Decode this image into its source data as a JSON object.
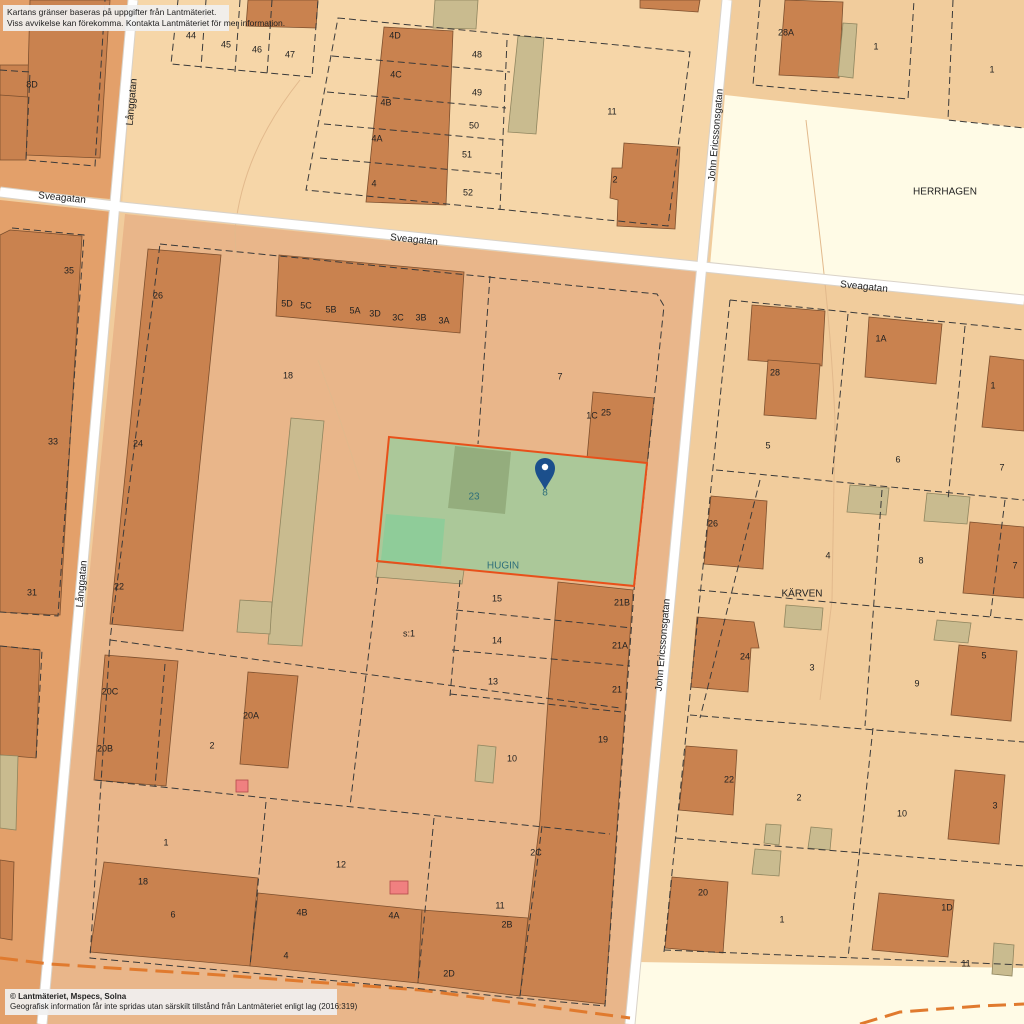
{
  "notice": {
    "line1": "Kartans gränser baseras på uppgifter från Lantmäteriet.",
    "line2": "Viss avvikelse kan förekomma. Kontakta Lantmäteriet för mer information."
  },
  "credit": {
    "line1": "© Lantmäteriet, Mspecs, Solna",
    "line2": "Geografisk information får inte spridas utan särskilt tillstånd från Lantmäteriet enligt lag (2016:319)"
  },
  "streets": {
    "sveagatan_west": "Sveagatan",
    "sveagatan_mid": "Sveagatan",
    "sveagatan_east": "Sveagatan",
    "langgatan_north": "Långgatan",
    "langgatan_south": "Långgatan",
    "john_north": "John Ericssonsgatan",
    "john_south": "John Ericssonsgatan"
  },
  "areas": {
    "herrhagen": "HERRHAGEN",
    "karven": "KÄRVEN",
    "hugin": "HUGIN"
  },
  "selected_property": {
    "marker_label": "8",
    "inner_label": "23",
    "outline_color": "#e8501a",
    "fill_color": "#a8c99a",
    "marker_color": "#1b4f8c"
  },
  "colors": {
    "block_hugin": "#e9b68a",
    "block_residential": "#f1cc9c",
    "open_area": "#fffbe6",
    "building": "#c9824f",
    "boundary_line": "#e07a2e"
  },
  "labels": {
    "l8D": "8D",
    "l44": "44",
    "l45": "45",
    "l46": "46",
    "l47": "47",
    "l4D": "4D",
    "l4C": "4C",
    "l4B": "4B",
    "l4A": "4A",
    "l4n": "4",
    "l48": "48",
    "l49": "49",
    "l50": "50",
    "l51": "51",
    "l52": "52",
    "l11n": "11",
    "l2n": "2",
    "l28A": "28A",
    "l1ne": "1",
    "l1ne2": "1",
    "l35": "35",
    "l33": "33",
    "l31": "31",
    "l26": "26",
    "l24": "24",
    "l22": "22",
    "l18": "18",
    "l5D": "5D",
    "l5C": "5C",
    "l5B": "5B",
    "l5A": "5A",
    "l3D": "3D",
    "l3C": "3C",
    "l3B": "3B",
    "l3A": "3A",
    "l7": "7",
    "l1C": "1C",
    "l25": "25",
    "l15": "15",
    "l14": "14",
    "l13": "13",
    "ls1": "s:1",
    "l21B": "21B",
    "l21A": "21A",
    "l21": "21",
    "l19": "19",
    "l10": "10",
    "l20C": "20C",
    "l20B": "20B",
    "l20A": "20A",
    "l2w": "2",
    "l1s": "1",
    "l12": "12",
    "l18s": "18",
    "l6s": "6",
    "l4Bs": "4B",
    "l4As": "4A",
    "l4s": "4",
    "l11s": "11",
    "l2C": "2C",
    "l2B": "2B",
    "l2D": "2D",
    "l28": "28",
    "l1A": "1A",
    "l1e": "1",
    "l5e": "5",
    "l6e": "6",
    "l7e": "7",
    "l26e": "26",
    "l4e": "4",
    "l8e": "8",
    "l7e2": "7",
    "l24e": "24",
    "l3e": "3",
    "l9e": "9",
    "l5e2": "5",
    "l22e": "22",
    "l2e": "2",
    "l10e": "10",
    "l3e2": "3",
    "l20e": "20",
    "l1e2": "1",
    "l1D": "1D",
    "l11e": "11"
  }
}
